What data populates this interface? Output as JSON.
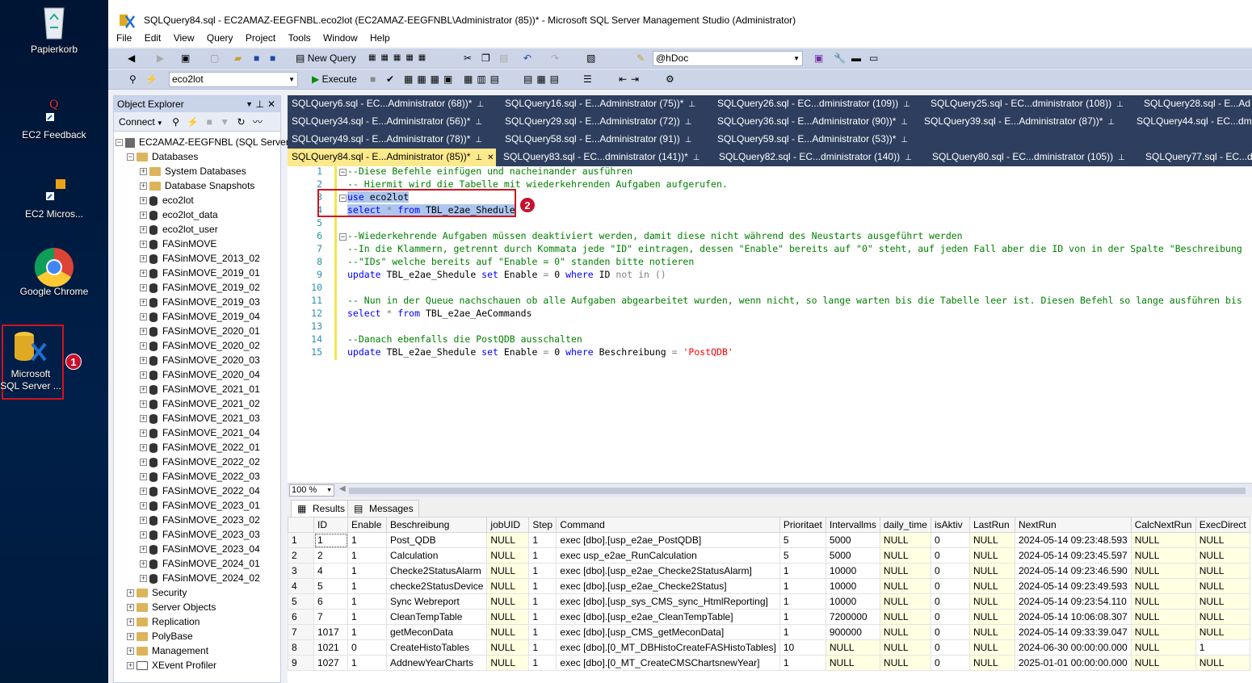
{
  "desktop": {
    "icons": [
      {
        "label": "Papierkorb"
      },
      {
        "label": "EC2 Feedback"
      },
      {
        "label": "EC2 Micros..."
      },
      {
        "label": "Google Chrome"
      },
      {
        "label": "Microsoft SQL Server ..."
      }
    ],
    "badge1": "1"
  },
  "window": {
    "title": "SQLQuery84.sql - EC2AMAZ-EEGFNBL.eco2lot (EC2AMAZ-EEGFNBL\\Administrator (85))* - Microsoft SQL Server Management Studio (Administrator)"
  },
  "menu": [
    "File",
    "Edit",
    "View",
    "Query",
    "Project",
    "Tools",
    "Window",
    "Help"
  ],
  "toolbar": {
    "new_query": "New Query",
    "param_combo": "@hDoc",
    "db_combo": "eco2lot",
    "execute": "Execute"
  },
  "object_explorer": {
    "title": "Object Explorer",
    "connect": "Connect",
    "server": "EC2AMAZ-EEGFNBL (SQL Server",
    "databases_label": "Databases",
    "db_items": [
      "System Databases",
      "Database Snapshots",
      "eco2lot",
      "eco2lot_data",
      "eco2lot_user",
      "FASinMOVE",
      "FASinMOVE_2013_02",
      "FASinMOVE_2019_01",
      "FASinMOVE_2019_02",
      "FASinMOVE_2019_03",
      "FASinMOVE_2019_04",
      "FASinMOVE_2020_01",
      "FASinMOVE_2020_02",
      "FASinMOVE_2020_03",
      "FASinMOVE_2020_04",
      "FASinMOVE_2021_01",
      "FASinMOVE_2021_02",
      "FASinMOVE_2021_03",
      "FASinMOVE_2021_04",
      "FASinMOVE_2022_01",
      "FASinMOVE_2022_02",
      "FASinMOVE_2022_03",
      "FASinMOVE_2022_04",
      "FASinMOVE_2023_01",
      "FASinMOVE_2023_02",
      "FASinMOVE_2023_03",
      "FASinMOVE_2023_04",
      "FASinMOVE_2024_01",
      "FASinMOVE_2024_02"
    ],
    "top_items": [
      "Security",
      "Server Objects",
      "Replication",
      "PolyBase",
      "Management",
      "XEvent Profiler"
    ]
  },
  "tabs": {
    "row1": [
      "SQLQuery6.sql - EC...Administrator (68))*",
      "SQLQuery16.sql - E...Administrator (75))*",
      "SQLQuery26.sql - EC...dministrator (109))",
      "SQLQuery25.sql - EC...dministrator (108))",
      "SQLQuery28.sql - E...Ad"
    ],
    "row2": [
      "SQLQuery34.sql - E...Administrator (56))*",
      "SQLQuery29.sql - E...Administrator (72))",
      "SQLQuery36.sql - E...Administrator (90))*",
      "SQLQuery39.sql - E...Administrator (87))*",
      "SQLQuery44.sql - EC...dmi"
    ],
    "row3": [
      "SQLQuery49.sql - E...Administrator (78))*",
      "SQLQuery58.sql - E...Administrator (91))",
      "SQLQuery59.sql - E...Administrator (53))*"
    ],
    "row4": [
      "SQLQuery84.sql - E...Administrator (85))*",
      "SQLQuery83.sql - EC...dministrator (141))*",
      "SQLQuery82.sql - EC...dministrator (140))",
      "SQLQuery80.sql - EC...dministrator (105))",
      "SQLQuery77.sql - EC...dm"
    ]
  },
  "editor": {
    "line_numbers": [
      "1",
      "2",
      "3",
      "4",
      "5",
      "6",
      "7",
      "8",
      "9",
      "10",
      "11",
      "12",
      "13",
      "14",
      "15"
    ],
    "l1": "--Diese Befehle einfügen und nacheinander ausführen",
    "l2": "-- Hiermit wird die Tabelle mit wiederkehrenden Aufgaben aufgerufen.",
    "l3a": "use",
    "l3b": " eco2lot",
    "l4a": "select",
    "l4b": " * ",
    "l4c": "from",
    "l4d": " TBL_e2ae_Shedule",
    "l6": "--Wiederkehrende Aufgaben müssen deaktiviert werden, damit diese nicht während des Neustarts ausgeführt werden",
    "l7": "--In die Klammern, getrennt durch Kommata jede \"ID\" eintragen, dessen \"Enable\" bereits auf \"0\" steht, auf jeden Fall aber die ID von in der Spalte \"Beschreibung",
    "l8": "--\"IDs\" welche bereits auf \"Enable = 0\" standen bitte notieren",
    "l9a": "update",
    "l9b": " TBL_e2ae_Shedule ",
    "l9c": "set",
    "l9d": " Enable ",
    "l9e": "=",
    "l9f": " 0 ",
    "l9g": "where",
    "l9h": " ID ",
    "l9i": "not in",
    "l9j": " ()",
    "l11": "-- Nun in der Queue nachschauen ob alle Aufgaben abgearbeitet wurden, wenn nicht, so lange warten bis die Tabelle leer ist. Diesen Befehl so lange ausführen bis",
    "l12a": "select",
    "l12b": " * ",
    "l12c": "from",
    "l12d": " TBL_e2ae_AeCommands",
    "l14": "--Danach ebenfalls die PostQDB ausschalten",
    "l15a": "update",
    "l15b": " TBL_e2ae_Shedule ",
    "l15c": "set",
    "l15d": " Enable ",
    "l15e": "=",
    "l15f": " 0 ",
    "l15g": "where",
    "l15h": " Beschreibung ",
    "l15i": "=",
    "l15j": " 'PostQDB'",
    "badge2": "2"
  },
  "zoom": "100 %",
  "results": {
    "tab_results": "Results",
    "tab_messages": "Messages",
    "columns": [
      "ID",
      "Enable",
      "Beschreibung",
      "jobUID",
      "Step",
      "Command",
      "Prioritaet",
      "Intervallms",
      "daily_time",
      "isAktiv",
      "LastRun",
      "NextRun",
      "CalcNextRun",
      "ExecDirect"
    ],
    "rows": [
      [
        "1",
        "1",
        "1",
        "Post_QDB",
        "NULL",
        "1",
        "exec [dbo].[usp_e2ae_PostQDB]",
        "5",
        "5000",
        "NULL",
        "0",
        "NULL",
        "2024-05-14 09:23:48.593",
        "NULL",
        "NULL"
      ],
      [
        "2",
        "2",
        "1",
        "Calculation",
        "NULL",
        "1",
        "exec usp_e2ae_RunCalculation",
        "5",
        "5000",
        "NULL",
        "0",
        "NULL",
        "2024-05-14 09:23:45.597",
        "NULL",
        "NULL"
      ],
      [
        "3",
        "4",
        "1",
        "Checke2StatusAlarm",
        "NULL",
        "1",
        "exec [dbo].[usp_e2ae_Checke2StatusAlarm]",
        "1",
        "10000",
        "NULL",
        "0",
        "NULL",
        "2024-05-14 09:23:46.590",
        "NULL",
        "NULL"
      ],
      [
        "4",
        "5",
        "1",
        "checke2StatusDevice",
        "NULL",
        "1",
        "exec [dbo].[usp_e2ae_Checke2Status]",
        "1",
        "10000",
        "NULL",
        "0",
        "NULL",
        "2024-05-14 09:23:49.593",
        "NULL",
        "NULL"
      ],
      [
        "5",
        "6",
        "1",
        "Sync Webreport",
        "NULL",
        "1",
        "exec [dbo].[usp_sys_CMS_sync_HtmlReporting]",
        "1",
        "10000",
        "NULL",
        "0",
        "NULL",
        "2024-05-14 09:23:54.110",
        "NULL",
        "NULL"
      ],
      [
        "6",
        "7",
        "1",
        "CleanTempTable",
        "NULL",
        "1",
        "exec [dbo].[usp_e2ae_CleanTempTable]",
        "1",
        "7200000",
        "NULL",
        "0",
        "NULL",
        "2024-05-14 10:06:08.307",
        "NULL",
        "NULL"
      ],
      [
        "7",
        "1017",
        "1",
        "getMeconData",
        "NULL",
        "1",
        "exec [dbo].[usp_CMS_getMeconData]",
        "1",
        "900000",
        "NULL",
        "0",
        "NULL",
        "2024-05-14 09:33:39.047",
        "NULL",
        "NULL"
      ],
      [
        "8",
        "1021",
        "0",
        "CreateHistoTables",
        "NULL",
        "1",
        "exec [dbo].[0_MT_DBHistoCreateFASHistoTables]",
        "10",
        "NULL",
        "NULL",
        "0",
        "NULL",
        "2024-06-30 00:00:00.000",
        "NULL",
        "1"
      ],
      [
        "9",
        "1027",
        "1",
        "AddnewYearCharts",
        "NULL",
        "1",
        "exec [dbo].[0_MT_CreateCMSChartsnewYear]",
        "1",
        "NULL",
        "NULL",
        "0",
        "NULL",
        "2025-01-01 00:00:00.000",
        "NULL",
        "NULL"
      ]
    ]
  },
  "colors": {
    "accent_red": "#d0141e",
    "tab_active": "#fce98c",
    "selection": "#adc6ef"
  }
}
